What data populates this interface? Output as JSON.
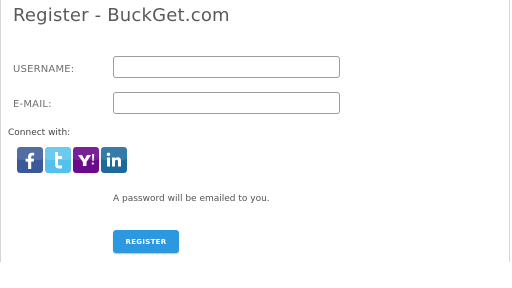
{
  "page": {
    "title": "Register - BuckGet.com"
  },
  "form": {
    "username_label": "USERNAME:",
    "username_value": "",
    "email_label": "E-MAIL:",
    "email_value": "",
    "connect_label": "Connect with:",
    "password_note": "A password will be emailed to you.",
    "register_label": "REGISTER"
  },
  "social": [
    {
      "icon": "facebook-icon",
      "color": "#3b5998"
    },
    {
      "icon": "twitter-icon",
      "color": "#55c0ec"
    },
    {
      "icon": "yahoo-icon",
      "color": "#6a0a8c"
    },
    {
      "icon": "linkedin-icon",
      "color": "#1c6a9c"
    }
  ],
  "colors": {
    "accent": "#2b98df"
  }
}
